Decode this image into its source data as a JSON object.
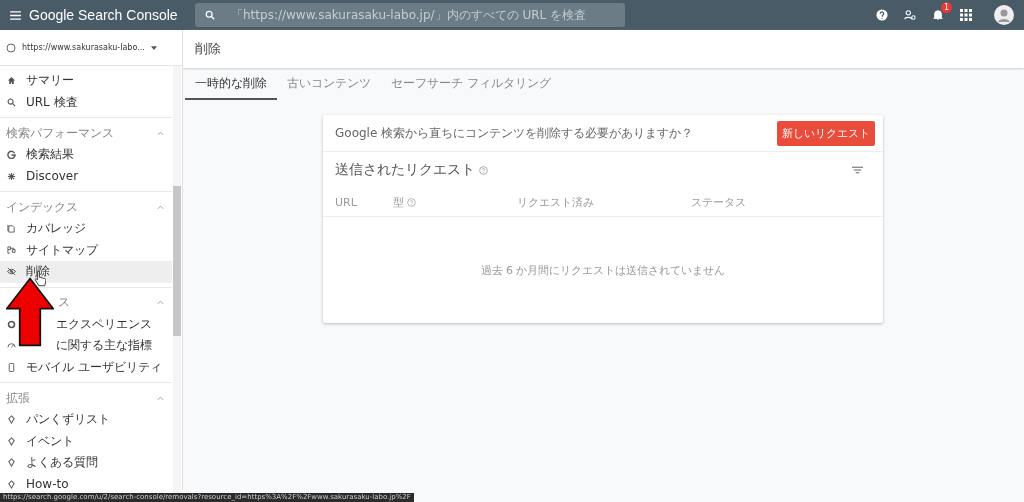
{
  "app_bar": {
    "title": "Google Search Console",
    "search": {
      "placeholder": "「https://www.sakurasaku-labo.jp/」内のすべての URL を検査"
    },
    "notification_badge": "1"
  },
  "sidebar": {
    "property": "https://www.sakurasaku-labo...",
    "sections": [
      {
        "items": [
          {
            "label": "サマリー",
            "selected": false
          },
          {
            "label": "URL 検査",
            "selected": false
          }
        ]
      },
      {
        "header": "検索パフォーマンス",
        "items": [
          {
            "label": "検索結果",
            "selected": false
          },
          {
            "label": "Discover",
            "selected": false
          }
        ]
      },
      {
        "header": "インデックス",
        "items": [
          {
            "label": "カバレッジ",
            "selected": false
          },
          {
            "label": "サイトマップ",
            "selected": false
          },
          {
            "label": "削除",
            "selected": true
          }
        ]
      },
      {
        "header": "ス",
        "items": [
          {
            "label": "エクスペリエンス",
            "selected": false
          },
          {
            "label": "に関する主な指標",
            "selected": false
          },
          {
            "label": "モバイル ユーザビリティ",
            "selected": false
          }
        ]
      },
      {
        "header": "拡張",
        "items": [
          {
            "label": "パンくずリスト",
            "selected": false
          },
          {
            "label": "イベント",
            "selected": false
          },
          {
            "label": "よくある質問",
            "selected": false
          },
          {
            "label": "How-to",
            "selected": false
          }
        ]
      }
    ]
  },
  "page": {
    "title": "削除",
    "tabs": [
      {
        "label": "一時的な削除",
        "selected": true
      },
      {
        "label": "古いコンテンツ",
        "selected": false
      },
      {
        "label": "セーフサーチ フィルタリング",
        "selected": false
      }
    ],
    "card": {
      "prompt": "Google 検索から直ちにコンテンツを削除する必要がありますか？",
      "new_request_button": "新しいリクエスト",
      "table_title": "送信されたリクエスト",
      "columns": [
        "URL",
        "型",
        "リクエスト済み",
        "ステータス"
      ],
      "empty_message": "過去 6 か月間にリクエストは送信されていません"
    }
  },
  "status_url": "https://search.google.com/u/2/search-console/removals?resource_id=https%3A%2F%2Fwww.sakurasaku-labo.jp%2F"
}
